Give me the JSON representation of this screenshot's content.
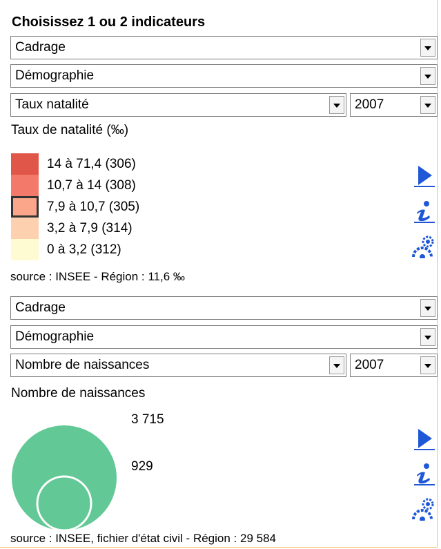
{
  "panel": {
    "title": "Choisissez 1 ou 2 indicateurs"
  },
  "indicator1": {
    "theme": "Cadrage",
    "domain": "Démographie",
    "indicator": "Taux natalité",
    "year": "2007",
    "legend_title": "Taux de natalité (‰)",
    "legend": [
      {
        "label": "14 à 71,4 (306)",
        "color": "#e0574a"
      },
      {
        "label": "10,7 à 14 (308)",
        "color": "#f37a6b"
      },
      {
        "label": "7,9 à 10,7 (305)",
        "color": "#fba58a",
        "selected": true
      },
      {
        "label": "3,2 à 7,9 (314)",
        "color": "#fdd1b0"
      },
      {
        "label": "0 à 3,2 (312)",
        "color": "#fefbd2"
      }
    ],
    "source": "source : INSEE - Région : 11,6 ‰"
  },
  "indicator2": {
    "theme": "Cadrage",
    "domain": "Démographie",
    "indicator": "Nombre de naissances",
    "year": "2007",
    "legend_title": "Nombre de naissances",
    "circle_large_value": "3 715",
    "circle_small_value": "929",
    "circle_color": "#62c895",
    "source": "source : INSEE, fichier d'état civil - Région : 29 584"
  },
  "icons": {
    "play": "play-icon",
    "info": "info-icon",
    "settings": "settings-gear-icon"
  }
}
